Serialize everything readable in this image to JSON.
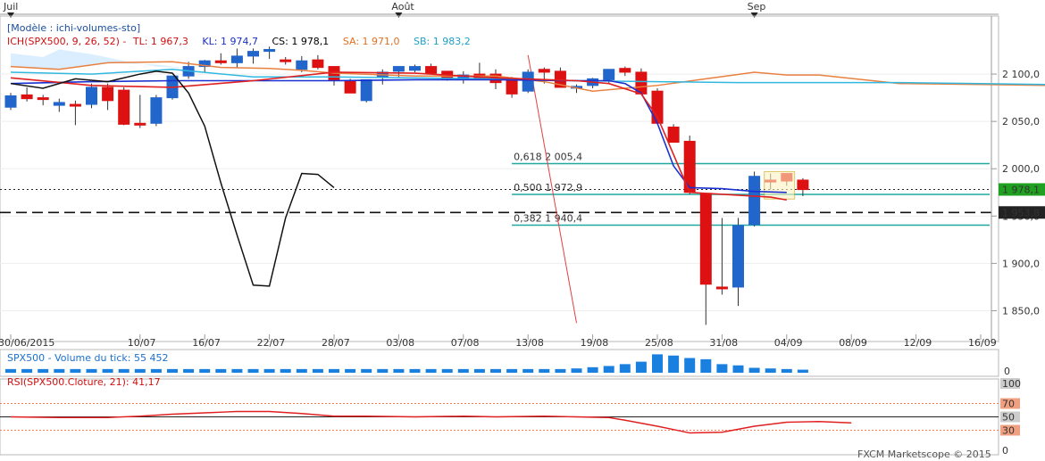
{
  "chart_data": {
    "type": "candlestick",
    "months": [
      {
        "label": "Juil",
        "index": 0
      },
      {
        "label": "Août",
        "index": 24
      },
      {
        "label": "Sep",
        "index": 46
      }
    ],
    "date_ticks": [
      {
        "label": "30/06/2015",
        "index": 0
      },
      {
        "label": "10/07",
        "index": 8
      },
      {
        "label": "16/07",
        "index": 12
      },
      {
        "label": "22/07",
        "index": 16
      },
      {
        "label": "28/07",
        "index": 20
      },
      {
        "label": "03/08",
        "index": 24
      },
      {
        "label": "07/08",
        "index": 28
      },
      {
        "label": "13/08",
        "index": 32
      },
      {
        "label": "19/08",
        "index": 36
      },
      {
        "label": "25/08",
        "index": 40
      },
      {
        "label": "31/08",
        "index": 44
      },
      {
        "label": "04/09",
        "index": 48
      },
      {
        "label": "08/09",
        "index": 52
      },
      {
        "label": "12/09",
        "index": 56
      },
      {
        "label": "16/09",
        "index": 60
      }
    ],
    "price_axis": {
      "min": 1825,
      "max": 2150,
      "ticks": [
        "2 100,0",
        "2 050,0",
        "2 000,0",
        "1 950,0",
        "1 900,0",
        "1 850,0"
      ],
      "tick_values": [
        2100,
        2050,
        2000,
        1950,
        1900,
        1850
      ]
    },
    "header": {
      "model": "[Modèle : ichi-volumes-sto]",
      "ich": "ICH(SPX500, 9, 26, 52) - ",
      "tl": "TL: 1 967,3",
      "kl": "KL: 1 974,7",
      "cs": "CS: 1 978,1",
      "sa": "SA: 1 971,0",
      "sb": "SB: 1 983,2"
    },
    "candles": [
      [
        2077,
        2080,
        2062,
        2065
      ],
      [
        2078,
        2086,
        2071,
        2074
      ],
      [
        2075,
        2078,
        2067,
        2075
      ],
      [
        2070,
        2074,
        2060,
        2067
      ],
      [
        2068,
        2072,
        2046,
        2068
      ],
      [
        2068,
        2090,
        2064,
        2086
      ],
      [
        2086,
        2090,
        2062,
        2072
      ],
      [
        2083,
        2086,
        2046,
        2047
      ],
      [
        2048,
        2078,
        2043,
        2048
      ],
      [
        2048,
        2078,
        2045,
        2075
      ],
      [
        2075,
        2098,
        2073,
        2098
      ],
      [
        2098,
        2113,
        2095,
        2108
      ],
      [
        2108,
        2115,
        2102,
        2114
      ],
      [
        2114,
        2122,
        2110,
        2112
      ],
      [
        2112,
        2127,
        2107,
        2119
      ],
      [
        2119,
        2127,
        2111,
        2124
      ],
      [
        2124,
        2129,
        2116,
        2126
      ],
      [
        2115,
        2118,
        2110,
        2114
      ],
      [
        2105,
        2119,
        2102,
        2114
      ],
      [
        2115,
        2120,
        2105,
        2107
      ],
      [
        2108,
        2108,
        2088,
        2094
      ],
      [
        2093,
        2095,
        2081,
        2080
      ],
      [
        2072,
        2094,
        2070,
        2094
      ],
      [
        2097,
        2105,
        2089,
        2102
      ],
      [
        2103,
        2107,
        2097,
        2108
      ],
      [
        2104,
        2110,
        2102,
        2108
      ],
      [
        2108,
        2111,
        2102,
        2101
      ],
      [
        2103,
        2103,
        2093,
        2095
      ],
      [
        2094,
        2103,
        2090,
        2099
      ],
      [
        2100,
        2112,
        2094,
        2096
      ],
      [
        2100,
        2105,
        2084,
        2091
      ],
      [
        2093,
        2097,
        2075,
        2079
      ],
      [
        2082,
        2105,
        2080,
        2102
      ],
      [
        2105,
        2107,
        2090,
        2102
      ],
      [
        2103,
        2107,
        2090,
        2086
      ],
      [
        2087,
        2089,
        2080,
        2087
      ],
      [
        2088,
        2096,
        2085,
        2095
      ],
      [
        2094,
        2104,
        2090,
        2105
      ],
      [
        2106,
        2108,
        2098,
        2102
      ],
      [
        2102,
        2106,
        2094,
        2079
      ],
      [
        2082,
        2085,
        2048,
        2048
      ],
      [
        2044,
        2047,
        2032,
        2028
      ],
      [
        2029,
        2035,
        1973,
        1975
      ],
      [
        1974,
        1974,
        1835,
        1878
      ],
      [
        1875,
        1948,
        1867,
        1874
      ],
      [
        1875,
        1948,
        1855,
        1940
      ],
      [
        1941,
        1997,
        1939,
        1992
      ],
      [
        1988,
        1995,
        1978,
        1986
      ],
      [
        1995,
        1995,
        1982,
        1987
      ],
      [
        1988,
        1990,
        1971,
        1978
      ]
    ],
    "candle_colors": [
      "#2266cc",
      "#dd1111",
      "#dd1111",
      "#2266cc",
      "#dd1111",
      "#2266cc",
      "#dd1111",
      "#dd1111",
      "#dd1111",
      "#2266cc",
      "#2266cc",
      "#2266cc",
      "#2266cc",
      "#dd1111",
      "#2266cc",
      "#2266cc",
      "#2266cc",
      "#dd1111",
      "#2266cc",
      "#dd1111",
      "#dd1111",
      "#dd1111",
      "#2266cc",
      "#2266cc",
      "#2266cc",
      "#2266cc",
      "#dd1111",
      "#dd1111",
      "#2266cc",
      "#dd1111",
      "#dd1111",
      "#dd1111",
      "#2266cc",
      "#dd1111",
      "#dd1111",
      "#2266cc",
      "#2266cc",
      "#2266cc",
      "#dd1111",
      "#dd1111",
      "#dd1111",
      "#dd1111",
      "#dd1111",
      "#dd1111",
      "#dd1111",
      "#2266cc",
      "#2266cc",
      "#dd1111",
      "#dd1111",
      "#dd1111"
    ],
    "lines": {
      "tenkan_red": [
        [
          0,
          2096
        ],
        [
          5,
          2088
        ],
        [
          10,
          2086
        ],
        [
          15,
          2093
        ],
        [
          20,
          2102
        ],
        [
          25,
          2101
        ],
        [
          30,
          2096
        ],
        [
          35,
          2093
        ],
        [
          37,
          2090
        ],
        [
          39,
          2079
        ],
        [
          40,
          2055
        ],
        [
          41,
          2015
        ],
        [
          42,
          1975
        ],
        [
          45,
          1972
        ],
        [
          47,
          1970
        ],
        [
          48,
          1967
        ]
      ],
      "kijun_blue": [
        [
          0,
          2090
        ],
        [
          5,
          2092
        ],
        [
          10,
          2093
        ],
        [
          15,
          2093
        ],
        [
          20,
          2093
        ],
        [
          25,
          2094
        ],
        [
          30,
          2094
        ],
        [
          35,
          2093
        ],
        [
          37,
          2093
        ],
        [
          38,
          2090
        ],
        [
          39,
          2080
        ],
        [
          40,
          2048
        ],
        [
          41,
          2003
        ],
        [
          42,
          1980
        ],
        [
          44,
          1979
        ],
        [
          46,
          1976
        ],
        [
          48,
          1975
        ]
      ],
      "chikou_black": [
        [
          0,
          2090
        ],
        [
          2,
          2085
        ],
        [
          4,
          2095
        ],
        [
          6,
          2092
        ],
        [
          8,
          2100
        ],
        [
          9,
          2103
        ],
        [
          10,
          2101
        ],
        [
          11,
          2080
        ],
        [
          12,
          2045
        ],
        [
          13,
          1985
        ],
        [
          14,
          1930
        ],
        [
          15,
          1877
        ],
        [
          16,
          1876
        ],
        [
          17,
          1948
        ],
        [
          18,
          1995
        ],
        [
          19,
          1994
        ],
        [
          20,
          1980
        ]
      ],
      "senkou_a_orange": [
        [
          0,
          2108
        ],
        [
          3,
          2105
        ],
        [
          6,
          2112
        ],
        [
          10,
          2113
        ],
        [
          13,
          2107
        ],
        [
          16,
          2106
        ],
        [
          18,
          2104
        ],
        [
          20,
          2101
        ],
        [
          25,
          2098
        ],
        [
          30,
          2098
        ],
        [
          33,
          2092
        ],
        [
          36,
          2082
        ],
        [
          40,
          2088
        ],
        [
          43,
          2095
        ],
        [
          46,
          2102
        ],
        [
          48,
          2099
        ],
        [
          50,
          2099
        ],
        [
          55,
          2090
        ],
        [
          60,
          2089
        ],
        [
          64,
          2088
        ]
      ],
      "senkou_b_cyan": [
        [
          0,
          2102
        ],
        [
          5,
          2100
        ],
        [
          10,
          2105
        ],
        [
          15,
          2097
        ],
        [
          20,
          2097
        ],
        [
          25,
          2096
        ],
        [
          30,
          2095
        ],
        [
          35,
          2093
        ],
        [
          40,
          2092
        ],
        [
          45,
          2091
        ],
        [
          50,
          2091
        ],
        [
          55,
          2091
        ],
        [
          60,
          2090
        ],
        [
          64,
          2089
        ]
      ]
    },
    "cloud_top": [
      [
        0,
        2122
      ],
      [
        2,
        2118
      ],
      [
        3,
        2126
      ],
      [
        5,
        2121
      ],
      [
        7,
        2114
      ],
      [
        9,
        2108
      ],
      [
        11,
        2106
      ]
    ],
    "cloud_bottom": [
      [
        0,
        2108
      ],
      [
        3,
        2105
      ],
      [
        6,
        2112
      ],
      [
        9,
        2110
      ],
      [
        11,
        2106
      ]
    ],
    "levels": [
      {
        "label": "0,618 2 005,4",
        "value": 2005.4,
        "color": "#20a8a0"
      },
      {
        "label": "0,500 1 972,9",
        "value": 1972.9,
        "color": "#20a8a0"
      },
      {
        "label": "0,382 1 940,4",
        "value": 1940.4,
        "color": "#20a8a0"
      }
    ],
    "current_price": {
      "label": "1 978,1",
      "value": 1978.1,
      "color": "#20a020"
    },
    "dashed_level": {
      "label": "1 953,8",
      "value": 1953.8
    },
    "fib_trend": [
      [
        32,
        2120
      ],
      [
        35,
        1837
      ]
    ],
    "volume": {
      "label": "SPX500 - Volume du tick: 55 452",
      "axis_label": "0",
      "values": [
        6,
        6,
        6,
        6,
        6,
        6,
        6,
        6,
        6,
        6,
        6,
        6,
        6,
        6,
        6,
        6,
        6,
        6,
        6,
        6,
        6,
        6,
        6,
        6,
        6,
        6,
        6,
        6,
        6,
        6,
        6,
        6,
        6,
        6,
        6,
        7,
        9,
        11,
        14,
        18,
        30,
        28,
        24,
        22,
        14,
        12,
        8,
        7,
        6,
        5
      ],
      "max": 32
    },
    "rsi": {
      "label": "RSI(SPX500.Cloture, 21): 41,17",
      "ticks": [
        "100",
        "70",
        "50",
        "30",
        "0"
      ],
      "tick_values": [
        100,
        70,
        50,
        30,
        0
      ],
      "values": [
        [
          0,
          50
        ],
        [
          3,
          49
        ],
        [
          6,
          49
        ],
        [
          8,
          51
        ],
        [
          10,
          54
        ],
        [
          12,
          56
        ],
        [
          14,
          58
        ],
        [
          16,
          58
        ],
        [
          18,
          55
        ],
        [
          20,
          51
        ],
        [
          22,
          51
        ],
        [
          25,
          50
        ],
        [
          28,
          51
        ],
        [
          30,
          50
        ],
        [
          33,
          51
        ],
        [
          35,
          50
        ],
        [
          37,
          49
        ],
        [
          38,
          45
        ],
        [
          40,
          36
        ],
        [
          42,
          26
        ],
        [
          44,
          27
        ],
        [
          46,
          36
        ],
        [
          48,
          42
        ],
        [
          50,
          43
        ],
        [
          52,
          41
        ]
      ]
    },
    "watermark": "FXCM Marketscope © 2015"
  }
}
